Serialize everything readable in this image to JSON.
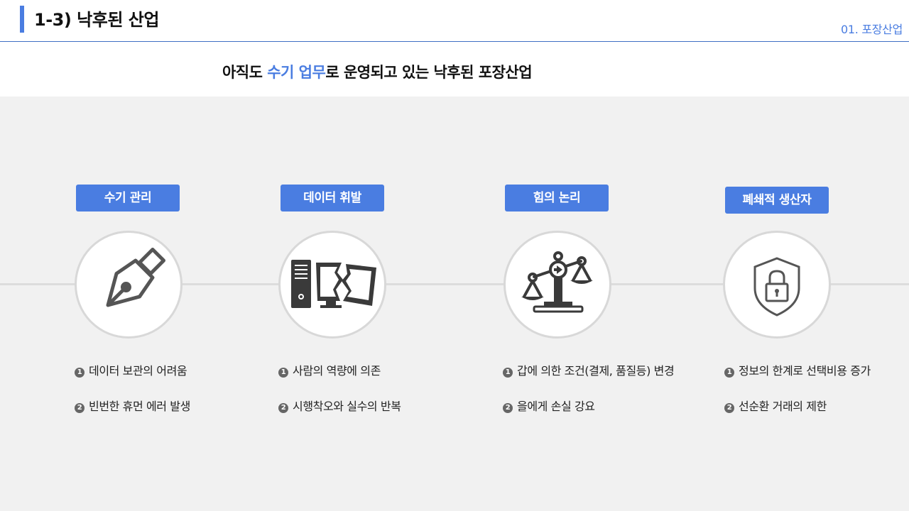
{
  "header": {
    "title": "1-3) 낙후된 산업",
    "section": "01. 포장산업"
  },
  "subtitle": {
    "before": "아직도 ",
    "highlight": "수기 업무",
    "after": "로 운영되고 있는 낙후된 포장산업"
  },
  "colors": {
    "accent": "#4a7de1",
    "panel": "#f1f1f1"
  },
  "columns": [
    {
      "badge": "수기 관리",
      "icon": "fountain-pen-icon",
      "items": [
        {
          "num": "1",
          "text": "데이터 보관의 어려움"
        },
        {
          "num": "2",
          "text": "빈번한 휴먼 에러 발생"
        }
      ]
    },
    {
      "badge": "데이터 휘발",
      "icon": "broken-computer-icon",
      "items": [
        {
          "num": "1",
          "text": "사람의 역량에 의존"
        },
        {
          "num": "2",
          "text": "시행착오와 실수의 반복"
        }
      ]
    },
    {
      "badge": "힘의 논리",
      "icon": "unbalanced-scale-icon",
      "items": [
        {
          "num": "1",
          "text": "갑에 의한 조건(결제, 품질등) 변경"
        },
        {
          "num": "2",
          "text": "을에게 손실 강요"
        }
      ]
    },
    {
      "badge": "폐쇄적 생산자",
      "icon": "shield-lock-icon",
      "items": [
        {
          "num": "1",
          "text": "정보의 한계로 선택비용 증가"
        },
        {
          "num": "2",
          "text": "선순환 거래의 제한"
        }
      ]
    }
  ]
}
